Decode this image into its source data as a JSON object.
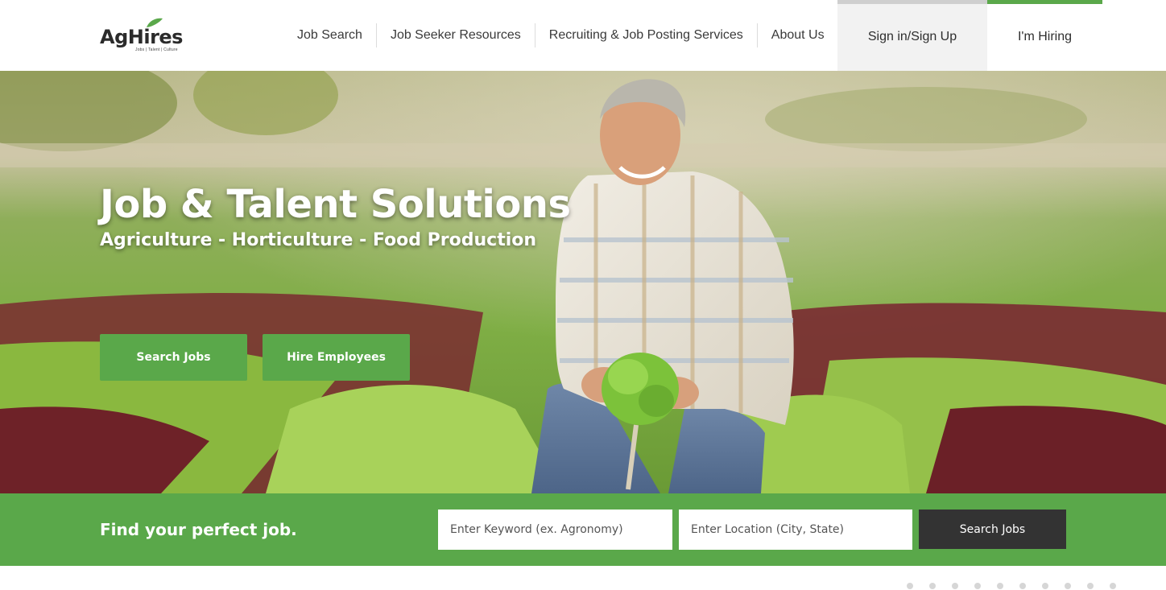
{
  "brand": {
    "name": "AgHires",
    "tagline": "Jobs | Talent | Culture",
    "accent_color": "#5aa84a",
    "dark_color": "#333333"
  },
  "nav": {
    "items": [
      {
        "label": "Job Search"
      },
      {
        "label": "Job Seeker Resources"
      },
      {
        "label": "Recruiting & Job Posting Services"
      },
      {
        "label": "About Us"
      }
    ],
    "signin_label": "Sign in/Sign Up",
    "hiring_label": "I'm Hiring"
  },
  "hero": {
    "title": "Job & Talent Solutions",
    "subtitle": "Agriculture - Horticulture - Food Production",
    "search_jobs_label": "Search Jobs",
    "hire_employees_label": "Hire Employees",
    "image_icon": "farmer-holding-lettuce-photo"
  },
  "search": {
    "heading": "Find your perfect job.",
    "keyword_placeholder": "Enter Keyword (ex. Agronomy)",
    "location_placeholder": "Enter Location (City, State)",
    "button_label": "Search Jobs"
  },
  "carousel": {
    "dot_count": 10
  }
}
